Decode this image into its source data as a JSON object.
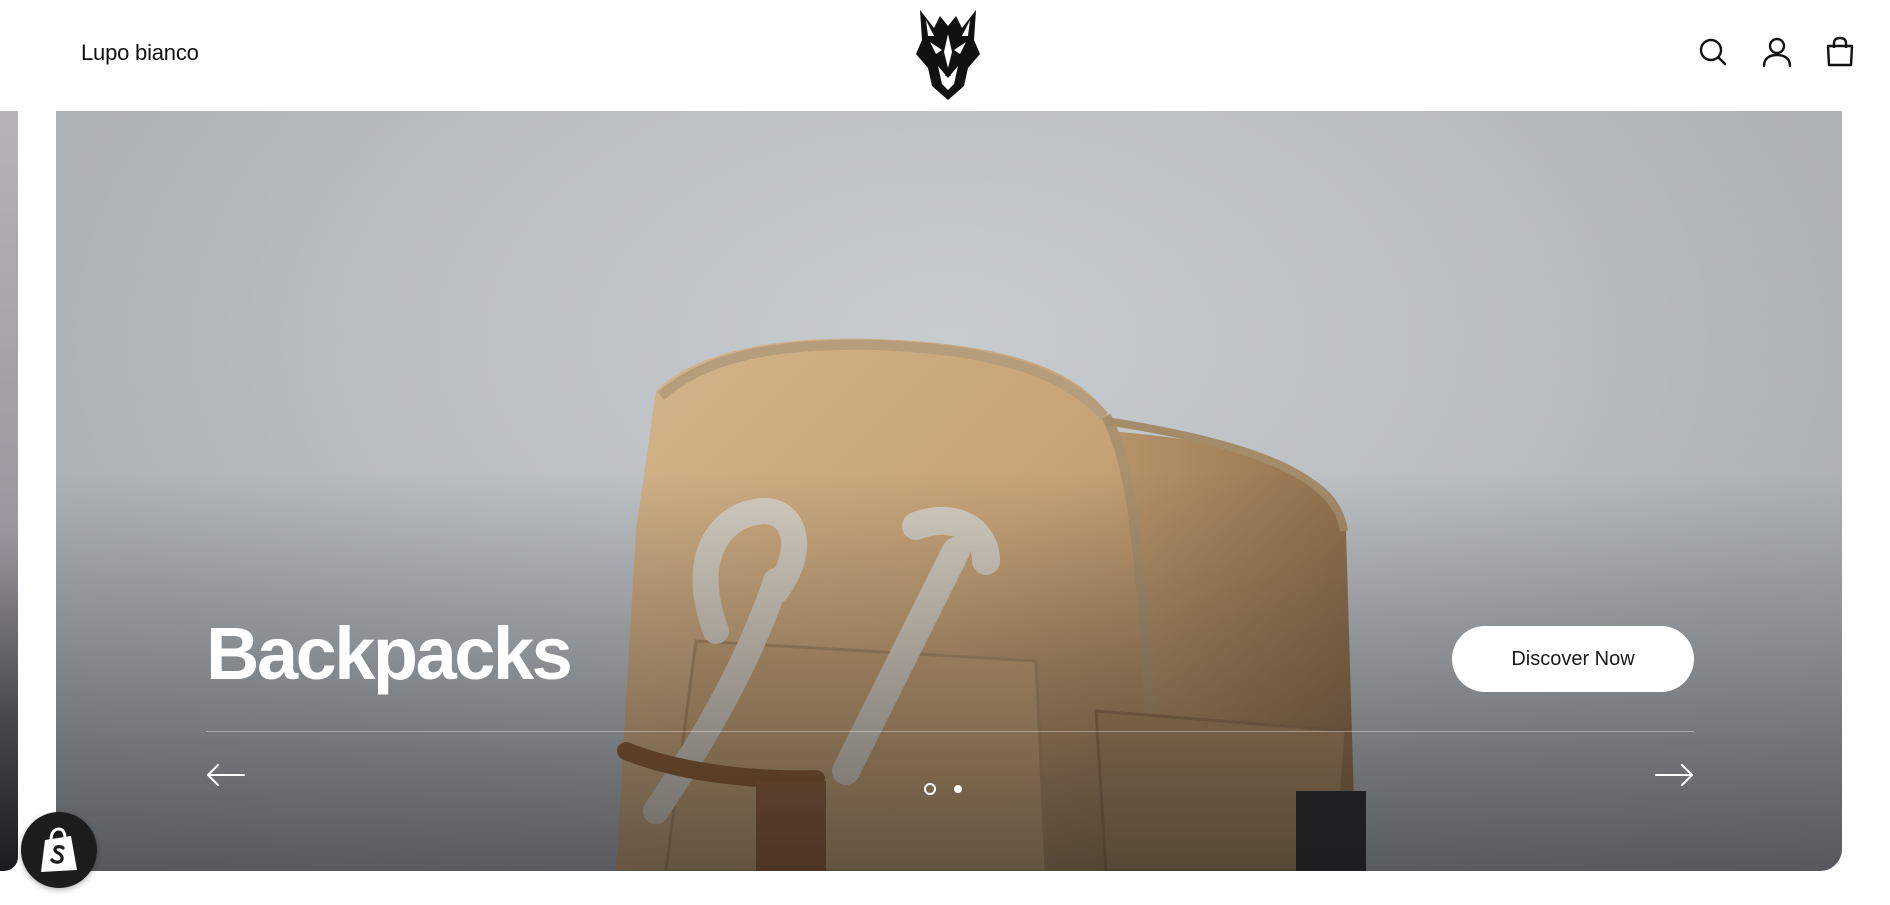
{
  "header": {
    "brand": "Lupo bianco",
    "icons": [
      "search-icon",
      "account-icon",
      "cart-icon"
    ]
  },
  "hero": {
    "title": "Backpacks",
    "cta_label": "Discover Now",
    "slides_total": 2,
    "active_slide": 1
  },
  "colors": {
    "hero_bg": "#b9bec2",
    "bag": "#c9a77c",
    "cta_bg": "#ffffff",
    "badge_bg": "#1c1c1c"
  }
}
